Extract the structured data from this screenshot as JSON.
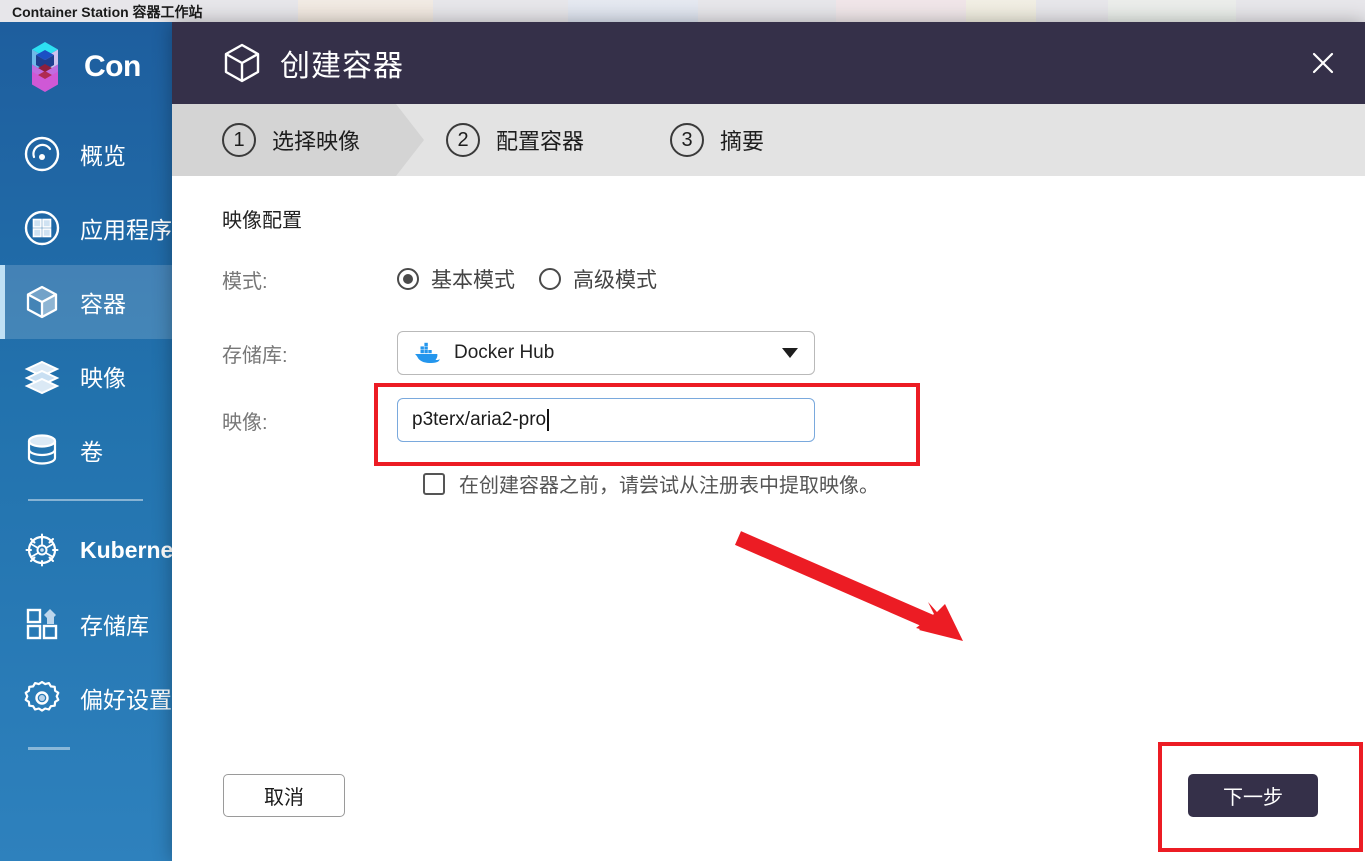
{
  "app": {
    "window_title": "Container Station 容器工作站",
    "brand_name": "Container Station",
    "brand_name_visible": "Con"
  },
  "sidebar": {
    "items": [
      {
        "label": "概览",
        "icon": "dashboard-gauge-icon",
        "active": false,
        "bold": false
      },
      {
        "label": "应用程序",
        "icon": "applications-grid-icon",
        "active": false,
        "bold": false
      },
      {
        "label": "容器",
        "icon": "container-cube-icon",
        "active": true,
        "bold": false
      },
      {
        "label": "映像",
        "icon": "images-layers-icon",
        "active": false,
        "bold": false
      },
      {
        "label": "卷",
        "icon": "volumes-database-icon",
        "active": false,
        "bold": false
      },
      {
        "label": "Kubernetes",
        "icon": "kubernetes-helm-icon",
        "active": false,
        "bold": true
      },
      {
        "label": "存储库",
        "icon": "registry-blocks-icon",
        "active": false,
        "bold": false
      },
      {
        "label": "偏好设置",
        "icon": "preferences-gear-icon",
        "active": false,
        "bold": false
      }
    ]
  },
  "dialog": {
    "title": "创建容器",
    "title_icon": "cube-outline-icon",
    "close_icon": "close-icon",
    "steps": [
      {
        "number": "1",
        "label": "选择映像",
        "active": true
      },
      {
        "number": "2",
        "label": "配置容器",
        "active": false
      },
      {
        "number": "3",
        "label": "摘要",
        "active": false
      }
    ],
    "section_title": "映像配置",
    "fields": {
      "mode_label": "模式:",
      "mode_options": [
        {
          "label": "基本模式",
          "selected": true
        },
        {
          "label": "高级模式",
          "selected": false
        }
      ],
      "registry_label": "存储库:",
      "registry_value": "Docker Hub",
      "registry_icon": "docker-whale-icon",
      "image_label": "映像:",
      "image_value": "p3terx/aria2-pro",
      "image_placeholder": "",
      "pull_checkbox_label": "在创建容器之前，请尝试从注册表中提取映像。",
      "pull_checkbox_checked": false
    },
    "buttons": {
      "cancel": "取消",
      "next": "下一步"
    }
  },
  "annotations": {
    "highlight_color": "#ec1c24",
    "arrow": "red-arrow-pointing-to-next-button"
  },
  "colors": {
    "dialog_header": "#353049",
    "sidebar_top": "#1e5e9e",
    "sidebar_bottom": "#2e81bd",
    "stepper_bg": "#e3e3e3",
    "stepper_active": "#d4d4d4",
    "docker_blue": "#2496ed",
    "input_focus_border": "#7aa9dd"
  }
}
